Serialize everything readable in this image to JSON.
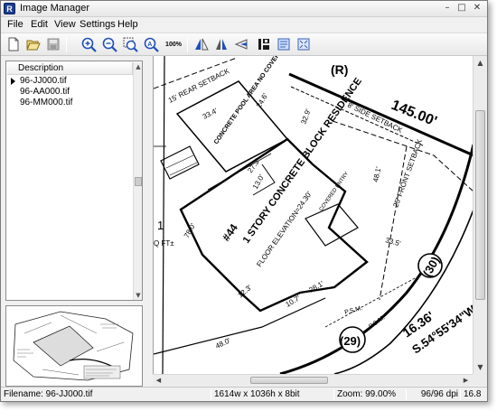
{
  "window": {
    "app_icon_letter": "R",
    "title": "Image Manager"
  },
  "menu": [
    "File",
    "Edit",
    "View",
    "Settings",
    "Help"
  ],
  "toolbar": {
    "zoom_100_label": "100%"
  },
  "file_list": {
    "header": "Description",
    "rows": [
      {
        "name": "96-JJ000.tif",
        "selected": true
      },
      {
        "name": "96-AA000.tif",
        "selected": false
      },
      {
        "name": "96-MM000.tif",
        "selected": false
      }
    ]
  },
  "plan": {
    "lot_marker": "(R)",
    "front_dimension": "145.00'",
    "side_setback": "8' SIDE SETBACK",
    "rear_setback": "15' REAR SETBACK",
    "pool_label": "CONCRETE POOL AREA NO COVER",
    "residence_title": "1 STORY CONCRETE BLOCK RESIDENCE",
    "lot_number": "#44",
    "floor_elevation": "FLOOR ELEVATION=24.30'",
    "front_setback": "25' FRONT SETBACK",
    "covered_entry": "COVERED ENTRY",
    "dim_33_4": "33.4'",
    "dim_32_9": "32.9'",
    "dim_24_6": "24.6'",
    "dim_27_3": "27.3'",
    "dim_13_0": "13.0'",
    "dim_48_1": "48.1'",
    "dim_33_5": "33.5'",
    "dim_78_0": "78.0'",
    "dim_48_0": "48.0'",
    "dim_28_1": "28.1'",
    "dim_10_7": "10.7'",
    "dim_12_3": "12.3'",
    "arc_16_36": "16.36'",
    "bearing": "S.54°55'34\"W.",
    "curve_30": "(30)",
    "curve_29": "(29)",
    "psm_1": "P.S.M.",
    "psm_2": "P.S.M.",
    "left_digit": "1",
    "left_sq": "Q FT±"
  },
  "status": {
    "filename": "Filename: 96-JJ000.tif",
    "dimensions": "1614w x 1036h x 8bit",
    "zoom": "Zoom: 99.00%",
    "dpi": "96/96 dpi",
    "extra": "16.8"
  }
}
